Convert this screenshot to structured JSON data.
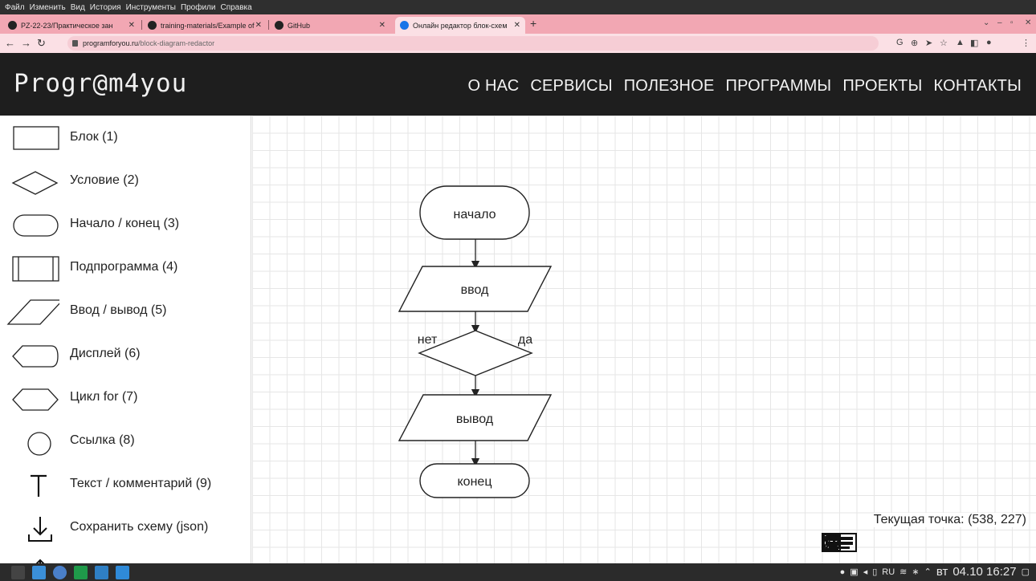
{
  "window_menu": [
    "Файл",
    "Изменить",
    "Вид",
    "История",
    "Инструменты",
    "Профили",
    "Справка"
  ],
  "tabs": [
    {
      "label": "PZ-22-23/Практическое зан"
    },
    {
      "label": "training-materials/Example of"
    },
    {
      "label": "GitHub"
    },
    {
      "label": "Онлайн редактор блок-схем"
    }
  ],
  "address": {
    "domain": "programforyou.ru",
    "path": "/block-diagram-redactor"
  },
  "site": {
    "logo": "Progr@m4you",
    "nav": [
      "О НАС",
      "СЕРВИСЫ",
      "ПОЛЕЗНОЕ",
      "ПРОГРАММЫ",
      "ПРОЕКТЫ",
      "КОНТАКТЫ"
    ]
  },
  "palette": [
    {
      "label": "Блок (1)",
      "icon": "rectangle-icon"
    },
    {
      "label": "Условие (2)",
      "icon": "diamond-icon"
    },
    {
      "label": "Начало / конец (3)",
      "icon": "terminator-icon"
    },
    {
      "label": "Подпрограмма (4)",
      "icon": "subroutine-icon"
    },
    {
      "label": "Ввод / вывод (5)",
      "icon": "parallelogram-icon"
    },
    {
      "label": "Дисплей (6)",
      "icon": "display-icon"
    },
    {
      "label": "Цикл for (7)",
      "icon": "hexagon-icon"
    },
    {
      "label": "Ссылка (8)",
      "icon": "circle-icon"
    },
    {
      "label": "Текст / комментарий (9)",
      "icon": "text-icon"
    },
    {
      "label": "Сохранить схему (json)",
      "icon": "download-icon"
    }
  ],
  "diagram": {
    "start": "начало",
    "input": "ввод",
    "condition_no": "нет",
    "condition_yes": "да",
    "output": "вывод",
    "end": "конец"
  },
  "status": {
    "current_point": "Текущая точка: (538, 227)"
  },
  "taskbar": {
    "lang": "RU",
    "day": "вт",
    "time": "04.10 16:27"
  }
}
